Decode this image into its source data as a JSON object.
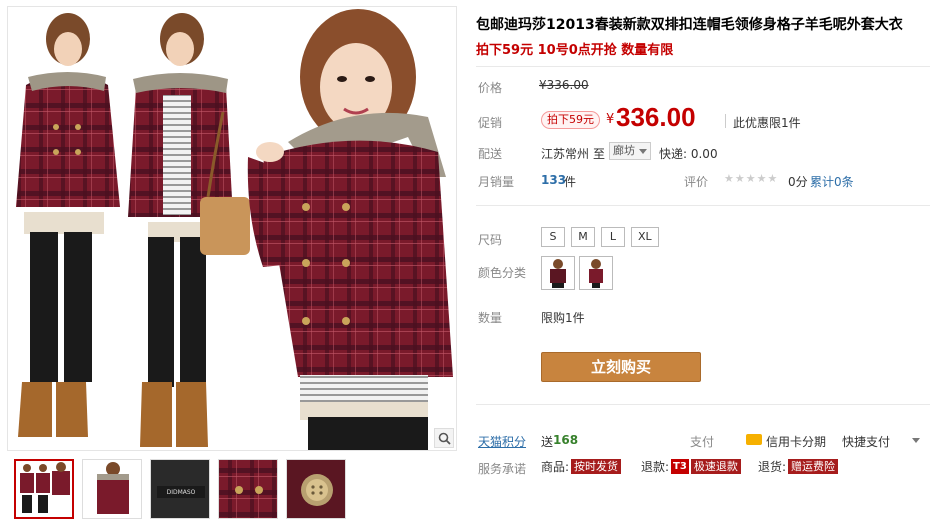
{
  "product": {
    "title": "包邮迪玛莎12013春装新款双排扣连帽毛领修身格子羊毛呢外套大衣",
    "subtitle": "拍下59元 10号0点开抢 数量有限"
  },
  "price": {
    "label": "价格",
    "original": "¥336.00"
  },
  "promo": {
    "label": "促销",
    "badge": "拍下59元",
    "currency": "¥",
    "amount": "336.00",
    "note": "此优惠限1件"
  },
  "shipping": {
    "label": "配送",
    "from": "江苏常州",
    "to_label": "至",
    "to_value": "廊坊",
    "express": "快递: 0.00"
  },
  "sales": {
    "label": "月销量",
    "count": "133",
    "unit": "件",
    "rating_label": "评价",
    "score": "0分",
    "cumulative": "累计0条",
    "stars": 0
  },
  "size": {
    "label": "尺码",
    "options": [
      "S",
      "M",
      "L",
      "XL"
    ]
  },
  "color": {
    "label": "颜色分类",
    "options": [
      "color-option-front",
      "color-option-side"
    ]
  },
  "quantity": {
    "label": "数量",
    "limit": "限购1件"
  },
  "buy_button": "立刻购买",
  "points": {
    "label": "天猫积分",
    "prefix": "送",
    "value": "168"
  },
  "payment": {
    "label": "支付",
    "card": "信用卡分期",
    "express_pay": "快捷支付"
  },
  "service": {
    "label": "服务承诺",
    "item1_prefix": "商品:",
    "item1_tag": "按时发货",
    "item2_prefix": "退款:",
    "item2_t3": "T3",
    "item2_tag": "极速退款",
    "item3_prefix": "退货:",
    "item3_tag": "赠运费险"
  },
  "thumbnail_brand": "DIDMASO",
  "colors": {
    "accent": "#c40000",
    "buy_button": "#c8843e",
    "plaid_dark": "#5a1622",
    "plaid_red": "#8c2033"
  }
}
